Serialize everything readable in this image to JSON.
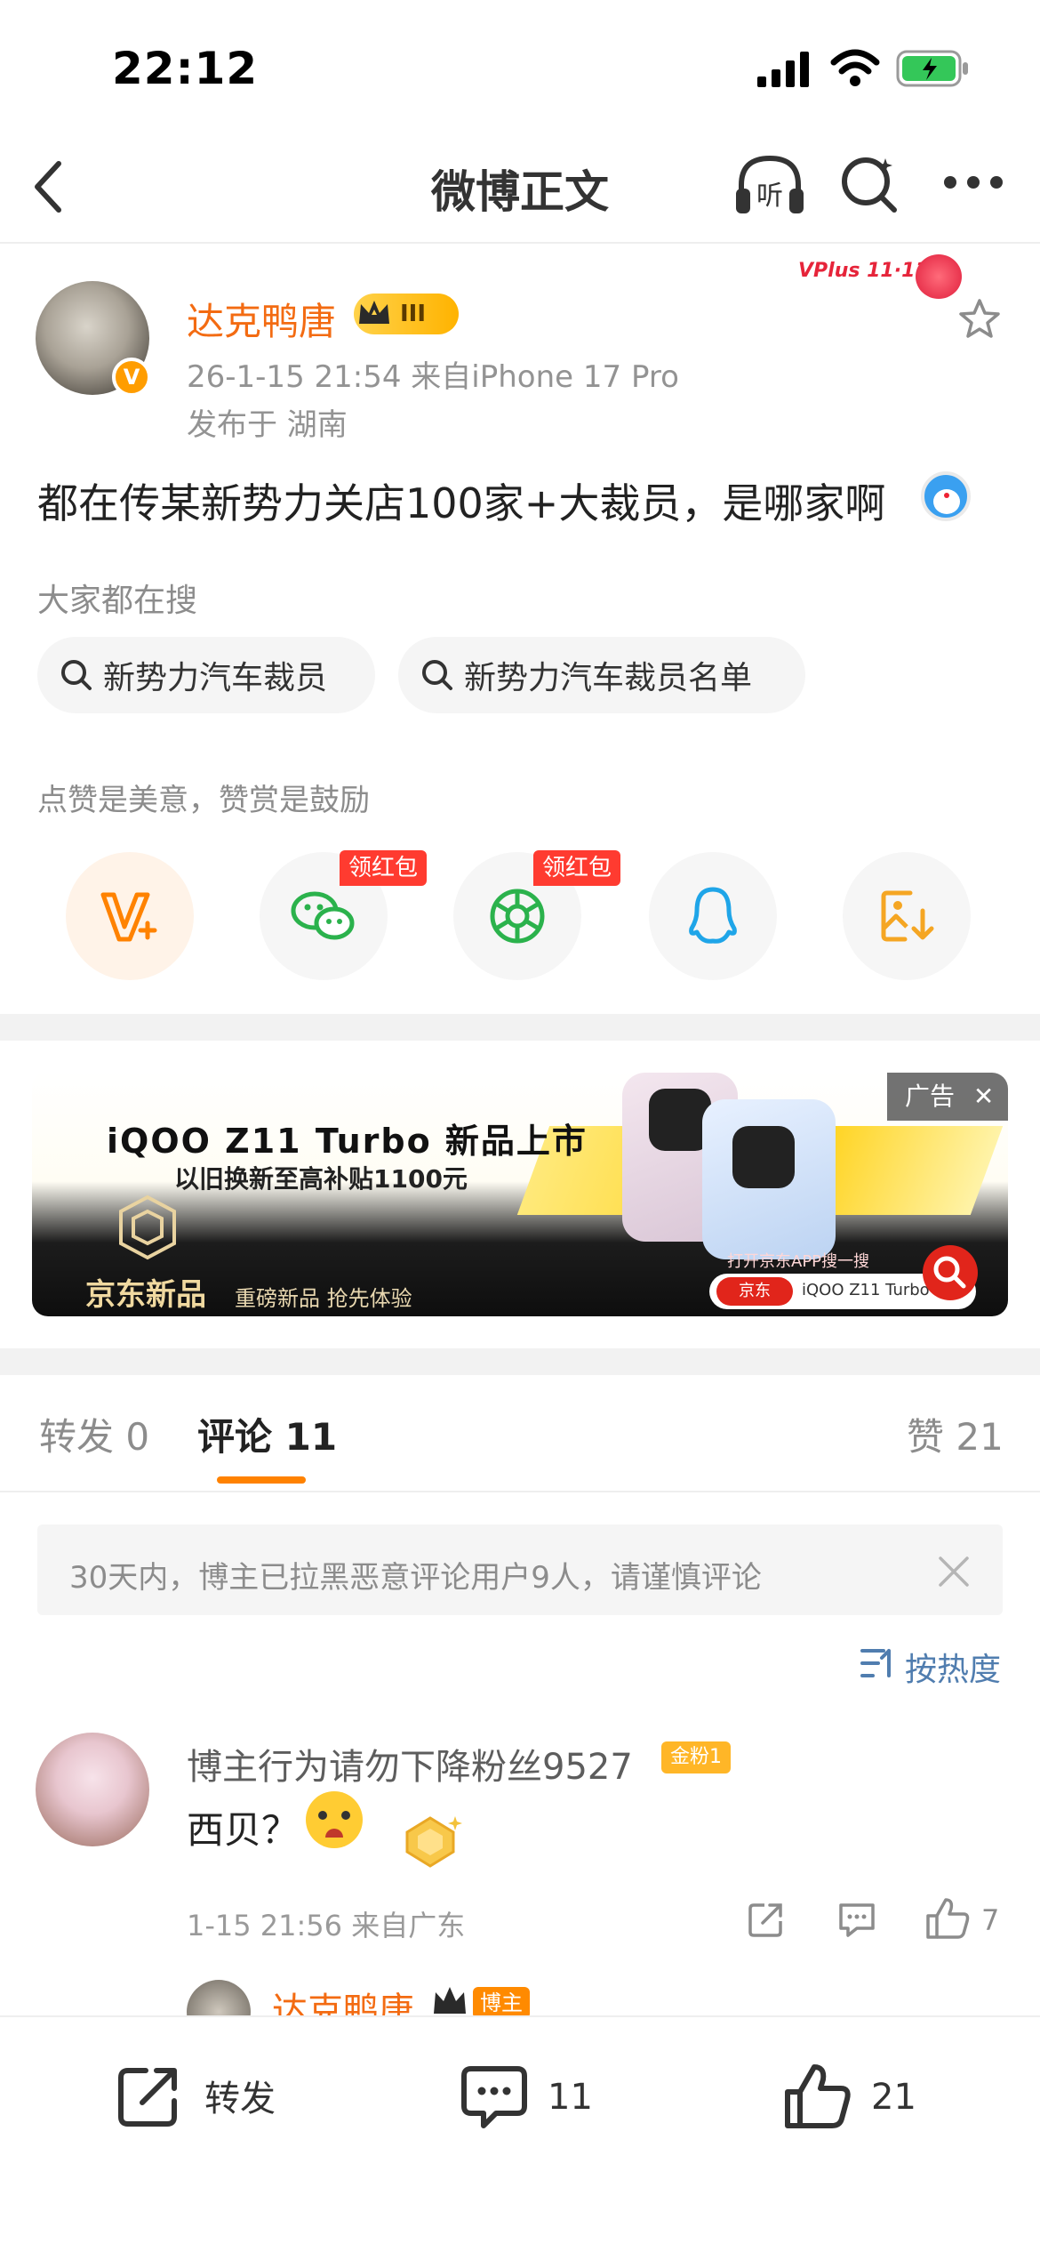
{
  "status_bar": {
    "time": "22:12"
  },
  "nav": {
    "title": "微博正文"
  },
  "post": {
    "author": "达克鸭唐",
    "level_badge": "III",
    "vip_badge": "VPlus 11·11",
    "time_source": "26-1-15 21:54  来自iPhone 17 Pro",
    "location": "发布于 湖南",
    "text": "都在传某新势力关店100家+大裁员，是哪家啊"
  },
  "search": {
    "hint": "大家都在搜",
    "chips": [
      "新势力汽车裁员",
      "新势力汽车裁员名单"
    ]
  },
  "reward": {
    "hint": "点赞是美意，赞赏是鼓励",
    "red_packet_label": "领红包"
  },
  "ad": {
    "label": "广告",
    "title": "iQOO Z11 Turbo 新品上市",
    "subtitle": "以旧换新至高补贴1100元",
    "brand": "京东新品",
    "slogan": "重磅新品  抢先体验",
    "cta": "打开京东APP搜一搜",
    "search_tag": "京东",
    "search_keyword": "iQOO Z11 Turbo"
  },
  "tabs": {
    "repost": "转发 0",
    "comment": "评论 11",
    "like": "赞 21"
  },
  "notice": {
    "text": "30天内，博主已拉黑恶意评论用户9人，请谨慎评论"
  },
  "sort": {
    "label": "按热度"
  },
  "comment": {
    "user": "博主行为请勿下降粉丝9527",
    "fan_badge": "金粉1",
    "text": "西贝？",
    "meta": "1-15 21:56  来自广东",
    "likes": "7",
    "reply_user": "达克鸭唐",
    "reply_tag": "博主"
  },
  "bottom_bar": {
    "repost_label": "转发",
    "comment_count": "11",
    "like_count": "21"
  },
  "colors": {
    "accent": "#ff8200",
    "username": "#f36b12",
    "link": "#507daf"
  }
}
